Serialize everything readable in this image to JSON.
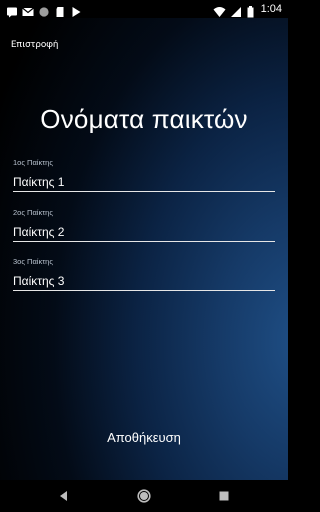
{
  "status_bar": {
    "time": "1:04",
    "left_icons": [
      "sms-icon",
      "gmail-icon",
      "circle-icon",
      "sd-card-icon",
      "play-store-icon"
    ],
    "right_icons": [
      "wifi-icon",
      "signal-icon",
      "battery-icon"
    ]
  },
  "header": {
    "back_label": "Επιστροφή",
    "title": "Ονόματα παικτών"
  },
  "players": [
    {
      "label": "1ος Παίκτης",
      "value": "Παίκτης 1"
    },
    {
      "label": "2ος Παίκτης",
      "value": "Παίκτης 2"
    },
    {
      "label": "3ος Παίκτης",
      "value": "Παίκτης 3"
    }
  ],
  "actions": {
    "save_label": "Αποθήκευση"
  },
  "nav_bar": {
    "icons": [
      "back-nav-icon",
      "home-nav-icon",
      "recents-nav-icon"
    ]
  },
  "colors": {
    "background_gradient": [
      "#000000",
      "#0b2344",
      "#1f4f86"
    ],
    "text": "#ffffff",
    "field_line": "#e6e6e6"
  }
}
